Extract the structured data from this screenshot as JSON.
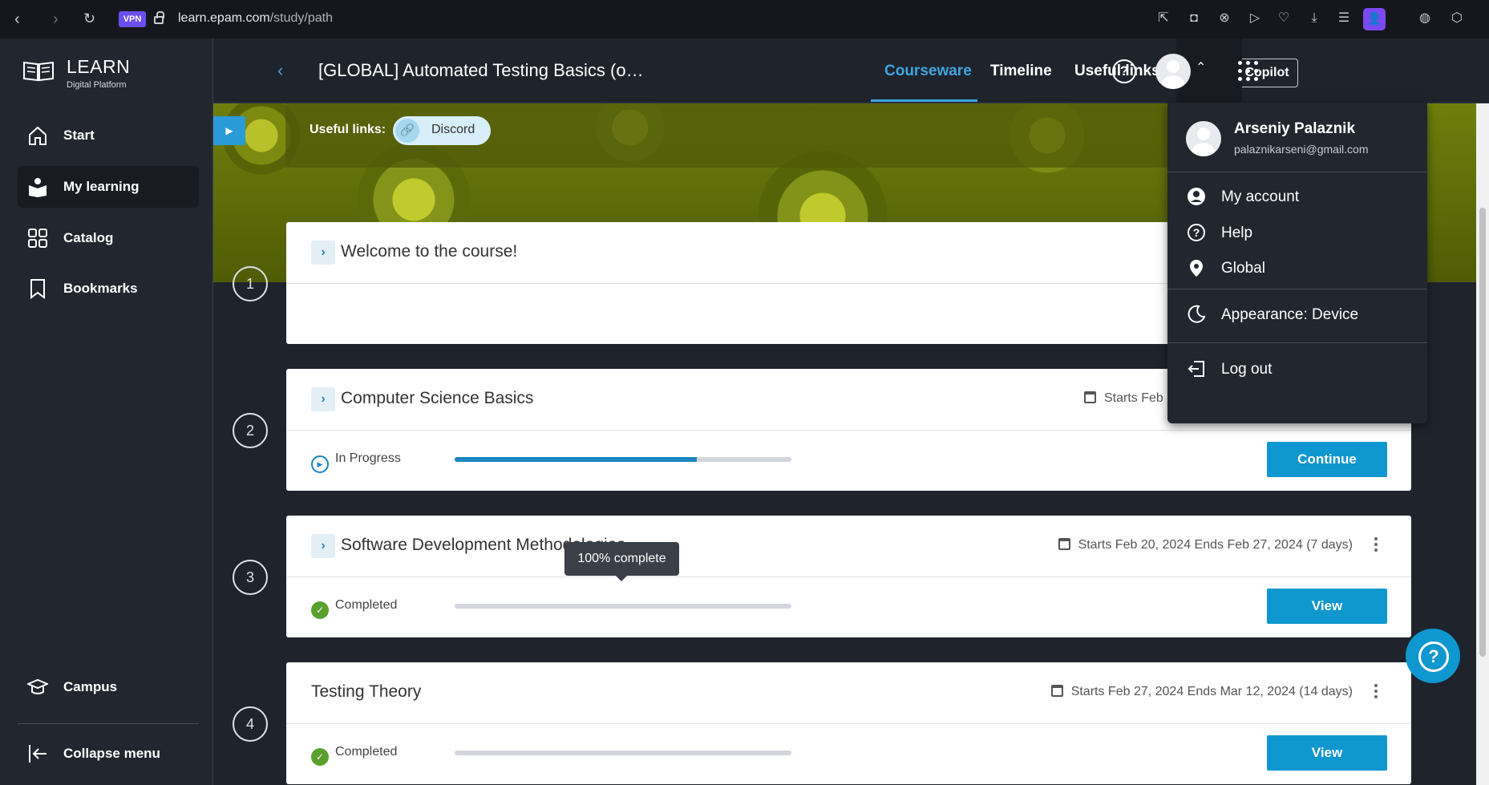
{
  "browser": {
    "vpn_label": "VPN",
    "url_domain": "learn.epam.com",
    "url_path": "/study/path"
  },
  "sidebar": {
    "logo_title": "LEARN",
    "logo_subtitle": "Digital Platform",
    "items": [
      {
        "label": "Start",
        "icon": "home-icon"
      },
      {
        "label": "My learning",
        "icon": "learning-icon",
        "active": true
      },
      {
        "label": "Catalog",
        "icon": "grid-icon"
      },
      {
        "label": "Bookmarks",
        "icon": "bookmark-icon"
      }
    ],
    "campus_label": "Campus",
    "collapse_label": "Collapse menu"
  },
  "topbar": {
    "course_title": "[GLOBAL] Automated Testing Basics (o…",
    "tabs": [
      "Courseware",
      "Timeline",
      "Useful links"
    ],
    "copilot_label": "AI Copilot"
  },
  "banner": {
    "useful_links_label": "Useful links:",
    "chip_label": "Discord"
  },
  "modules": [
    {
      "num": "1",
      "title": "Welcome to the course!"
    },
    {
      "num": "2",
      "title": "Computer Science Basics",
      "dates": "Starts Feb",
      "status": "In Progress",
      "progress": 0.72,
      "button": "Continue"
    },
    {
      "num": "3",
      "title": "Software Development Methodologies",
      "dates": "Starts Feb 20, 2024 Ends Feb 27, 2024 (7 days)",
      "status": "Completed",
      "progress": 1.0,
      "button": "View"
    },
    {
      "num": "4",
      "title": "Testing Theory",
      "dates": "Starts Feb 27, 2024 Ends Mar 12, 2024 (14 days)",
      "status": "Completed",
      "progress": 1.0,
      "button": "View"
    }
  ],
  "tooltip": "100% complete",
  "dropdown": {
    "name": "Arseniy Palaznik",
    "email": "palaznikarseni@gmail.com",
    "items": [
      "My account",
      "Help",
      "Global",
      "Appearance: Device",
      "Log out"
    ]
  },
  "colors": {
    "accent": "#0f97cf",
    "sidebar_bg": "#22262f",
    "completed": "#5aa02c"
  }
}
